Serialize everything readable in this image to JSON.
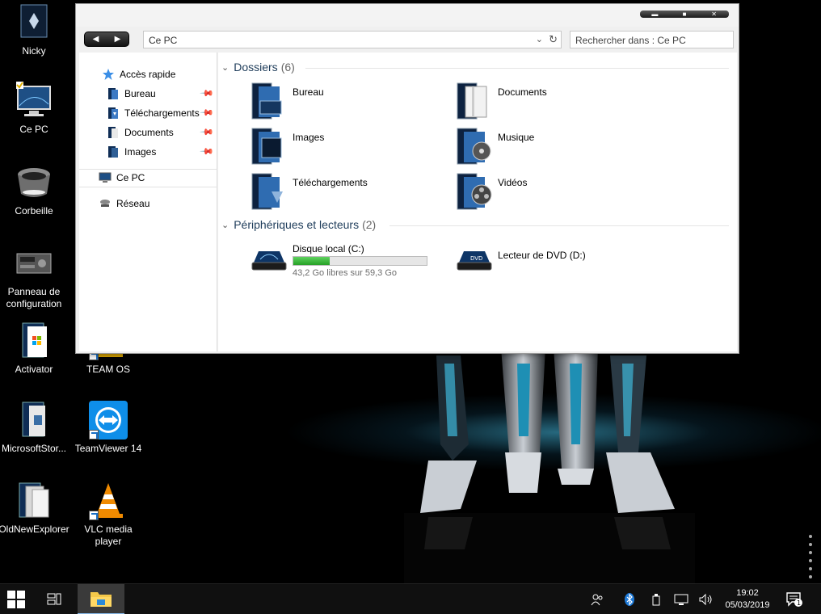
{
  "desktop": {
    "icons": [
      {
        "label": "Nicky"
      },
      {
        "label": "Ce PC"
      },
      {
        "label": "Corbeille"
      },
      {
        "label": "Panneau de configuration"
      },
      {
        "label": "Activator"
      },
      {
        "label": "TEAM OS"
      },
      {
        "label": "MicrosoftStor..."
      },
      {
        "label": "TeamViewer 14"
      },
      {
        "label": "OldNewExplorer"
      },
      {
        "label": "VLC media player"
      }
    ]
  },
  "window": {
    "controls": {
      "minimize": "▬",
      "maximize": "■",
      "close": "✕"
    },
    "nav_buttons": {
      "back": "◀",
      "forward": "▶"
    },
    "address": "Ce PC",
    "search_placeholder": "Rechercher dans : Ce PC",
    "navpane": {
      "quick_access": "Accès rapide",
      "pinned": [
        {
          "label": "Bureau"
        },
        {
          "label": "Téléchargements"
        },
        {
          "label": "Documents"
        },
        {
          "label": "Images"
        }
      ],
      "this_pc": "Ce PC",
      "network": "Réseau"
    },
    "groups": {
      "folders": {
        "title": "Dossiers",
        "count": "(6)"
      },
      "devices": {
        "title": "Périphériques et lecteurs",
        "count": "(2)"
      }
    },
    "folders": [
      {
        "label": "Bureau",
        "icon": "desktop-folder-icon"
      },
      {
        "label": "Documents",
        "icon": "documents-folder-icon"
      },
      {
        "label": "Images",
        "icon": "pictures-folder-icon"
      },
      {
        "label": "Musique",
        "icon": "music-folder-icon"
      },
      {
        "label": "Téléchargements",
        "icon": "downloads-folder-icon"
      },
      {
        "label": "Vidéos",
        "icon": "videos-folder-icon"
      }
    ],
    "drives": [
      {
        "name": "Disque local (C:)",
        "free": "43,2 Go libres sur 59,3 Go",
        "used_fraction": 0.27
      },
      {
        "name": "Lecteur de DVD (D:)"
      }
    ]
  },
  "taskbar": {
    "time": "19:02",
    "date": "05/03/2019",
    "notification_count": "1"
  },
  "colors": {
    "accent": "#1a6fc4",
    "drive_fill": "#26a026",
    "group_title": "#1e3c5a"
  }
}
